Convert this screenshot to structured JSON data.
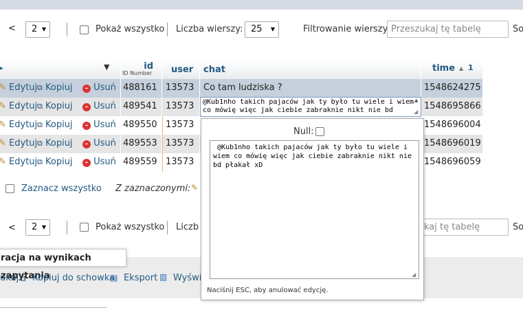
{
  "nav": {
    "prev": "<",
    "page": "2",
    "show_all": "Pokaż wszystko",
    "rows_label": "Liczba wierszy:",
    "rows_value": "25",
    "filter_label": "Filtrowanie wierszy:",
    "filter_placeholder": "Przeszukaj tę tabelę",
    "sort_cut": "So",
    "bottom_rows_cut": "Liczb",
    "bottom_search_cut": "kaj tę tabelę"
  },
  "table": {
    "columns": {
      "id": "id",
      "id_sub": "ID Number",
      "user": "user",
      "chat": "chat",
      "time": "time",
      "time_sort": "1"
    },
    "actions": {
      "edit": "Edytuj",
      "copy": "Kopiuj",
      "delete": "Usuń"
    },
    "rows": [
      {
        "id": "488161",
        "user": "13573",
        "chat": "Co tam ludziska ?",
        "time": "1548624275"
      },
      {
        "id": "489541",
        "user": "13573",
        "chat": "@Kub1nho takich pajaców jak ty było tu wiele i wiem co mówię więc jak ciebie zabraknie nikt nie bd",
        "time": "1548695866"
      },
      {
        "id": "489550",
        "user": "13573",
        "chat": "",
        "time": "1548696004"
      },
      {
        "id": "489553",
        "user": "13573",
        "chat": "",
        "time": "1548696019"
      },
      {
        "id": "489559",
        "user": "13573",
        "chat": "",
        "time": "1548696059"
      }
    ]
  },
  "select_all": "Zaznacz wszystko",
  "with_selected": "Z zaznaczonymi:",
  "editor": {
    "null_label": "Null:",
    "textarea": " @Kub1nho takich pajaców jak ty było tu wiele i wiem co mówię więc jak ciebie zabraknie nikt nie bd płakał xD",
    "hint": "Naciśnij ESC, aby anulować edycję."
  },
  "query_ops": {
    "title": "racja na wynikach zapytania",
    "print_cut": "ukuj",
    "copy_clipboard": "Kopiuj do schowka",
    "export": "Eksport",
    "display_cut": "Wyświ"
  }
}
